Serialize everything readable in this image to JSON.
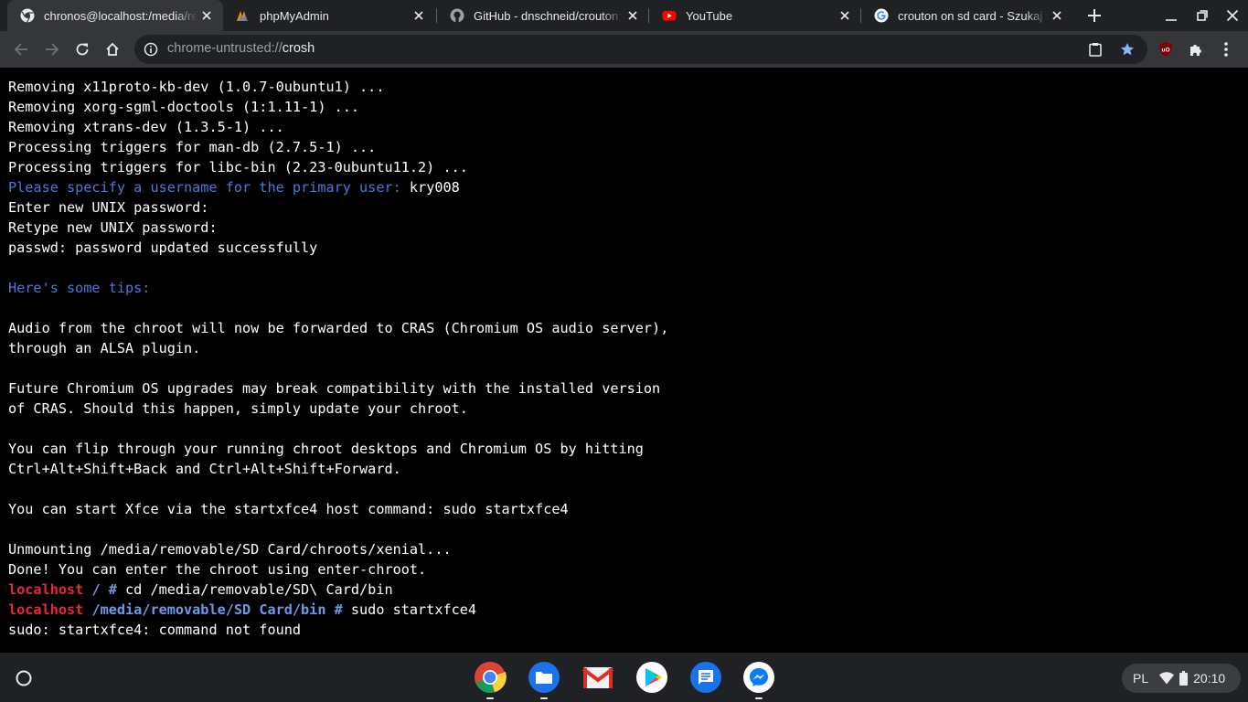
{
  "browser": {
    "tabs": [
      {
        "title": "chronos@localhost:/media/removable/SD Card/bin",
        "icon": "chrome-icon",
        "active": true
      },
      {
        "title": "phpMyAdmin",
        "icon": "phpmyadmin-icon",
        "active": false
      },
      {
        "title": "GitHub - dnschneid/crouton: Chromium OS Universal Chroot Environment",
        "icon": "github-icon",
        "active": false
      },
      {
        "title": "YouTube",
        "icon": "youtube-icon",
        "active": false
      },
      {
        "title": "crouton on sd card - Szukaj w Google",
        "icon": "google-icon",
        "active": false
      }
    ],
    "address_bar": {
      "scheme": "chrome-untrusted://",
      "host": "crosh"
    }
  },
  "terminal": {
    "lines": [
      [
        {
          "t": "Removing x11proto-kb-dev (1.0.7-0ubuntu1) ...",
          "c": ""
        }
      ],
      [
        {
          "t": "Removing xorg-sgml-doctools (1:1.11-1) ...",
          "c": ""
        }
      ],
      [
        {
          "t": "Removing xtrans-dev (1.3.5-1) ...",
          "c": ""
        }
      ],
      [
        {
          "t": "Processing triggers for man-db (2.7.5-1) ...",
          "c": ""
        }
      ],
      [
        {
          "t": "Processing triggers for libc-bin (2.23-0ubuntu11.2) ...",
          "c": ""
        }
      ],
      [
        {
          "t": "Please specify a username for the primary user: ",
          "c": "blue"
        },
        {
          "t": "kry008",
          "c": ""
        }
      ],
      [
        {
          "t": "Enter new UNIX password:",
          "c": ""
        }
      ],
      [
        {
          "t": "Retype new UNIX password:",
          "c": ""
        }
      ],
      [
        {
          "t": "passwd: password updated successfully",
          "c": ""
        }
      ],
      [],
      [
        {
          "t": "Here's some tips:",
          "c": "blue"
        }
      ],
      [],
      [
        {
          "t": "Audio from the chroot will now be forwarded to CRAS (Chromium OS audio server),",
          "c": ""
        }
      ],
      [
        {
          "t": "through an ALSA plugin.",
          "c": ""
        }
      ],
      [],
      [
        {
          "t": "Future Chromium OS upgrades may break compatibility with the installed version",
          "c": ""
        }
      ],
      [
        {
          "t": "of CRAS. Should this happen, simply update your chroot.",
          "c": ""
        }
      ],
      [],
      [
        {
          "t": "You can flip through your running chroot desktops and Chromium OS by hitting",
          "c": ""
        }
      ],
      [
        {
          "t": "Ctrl+Alt+Shift+Back and Ctrl+Alt+Shift+Forward.",
          "c": ""
        }
      ],
      [],
      [
        {
          "t": "You can start Xfce via the startxfce4 host command: sudo startxfce4",
          "c": ""
        }
      ],
      [],
      [
        {
          "t": "Unmounting /media/removable/SD Card/chroots/xenial...",
          "c": ""
        }
      ],
      [
        {
          "t": "Done! You can enter the chroot using enter-chroot.",
          "c": ""
        }
      ],
      [
        {
          "t": "localhost",
          "c": "red"
        },
        {
          "t": " / #",
          "c": "bblue"
        },
        {
          "t": " cd /media/removable/SD\\ Card/bin",
          "c": ""
        }
      ],
      [
        {
          "t": "localhost",
          "c": "red"
        },
        {
          "t": " /media/removable/SD Card/bin #",
          "c": "bblue"
        },
        {
          "t": " sudo startxfce4",
          "c": ""
        }
      ],
      [
        {
          "t": "sudo: startxfce4: command not found",
          "c": ""
        }
      ]
    ]
  },
  "shelf": {
    "apps": [
      {
        "name": "chrome-icon",
        "running": true
      },
      {
        "name": "files-icon",
        "running": true
      },
      {
        "name": "gmail-icon",
        "running": false
      },
      {
        "name": "play-store-icon",
        "running": false
      },
      {
        "name": "messages-icon",
        "running": false
      },
      {
        "name": "messenger-icon",
        "running": true
      }
    ],
    "tray": {
      "input_method": "PL",
      "time": "20:10"
    }
  },
  "colors": {
    "tab_strip": "#202124",
    "toolbar": "#35363a",
    "terminal_bg": "#000000",
    "terminal_text": "#ffffff",
    "prompt_host": "#e8283a",
    "prompt_path": "#6d9ae6",
    "info_text": "#4a7ad8",
    "bookmark_star": "#8ab4f8"
  }
}
